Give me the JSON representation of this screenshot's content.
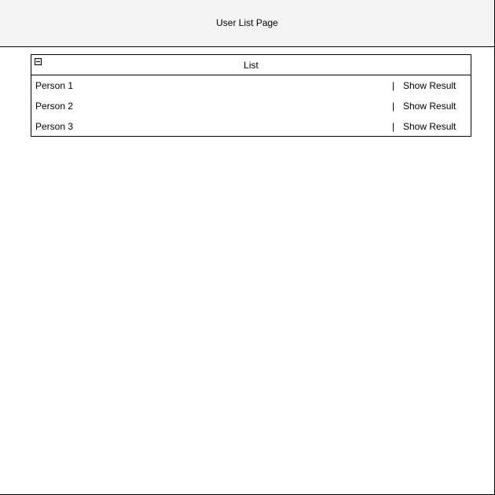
{
  "header": {
    "title": "User List Page"
  },
  "list": {
    "title": "List",
    "collapse_icon": "collapse-minus-icon",
    "separator": "|",
    "rows": [
      {
        "name": "Person 1",
        "action": "Show Result"
      },
      {
        "name": "Person 2",
        "action": "Show Result"
      },
      {
        "name": "Person 3",
        "action": "Show Result"
      }
    ]
  },
  "colors": {
    "header_bg": "#f4f4f4",
    "border": "#000000",
    "background": "#ffffff"
  }
}
